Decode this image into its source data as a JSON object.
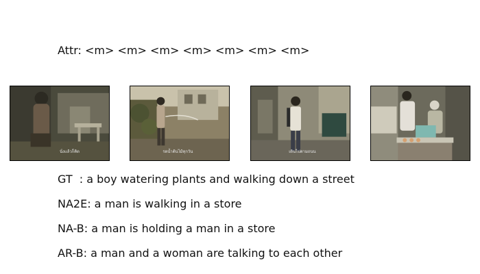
{
  "attributes": {
    "label": "Attr:",
    "tokens": [
      "<m>",
      "<m>",
      "<m>",
      "<m>",
      "<m>",
      "<m>",
      "<m>"
    ]
  },
  "frames": [
    {
      "subtitle": "นั่งแล้วก็คิด"
    },
    {
      "subtitle": "รดน้ำต้นไม้ทุกวัน"
    },
    {
      "subtitle": "เดินไปตามถนน"
    },
    {
      "subtitle": ""
    }
  ],
  "captions": {
    "gt": "GT  : a boy watering plants and walking down a street",
    "na2e": "NA2E: a man is walking in a store",
    "nab": "NA-B: a man is holding a man in a store",
    "arb": "AR-B: a man and a woman are talking to each other"
  }
}
